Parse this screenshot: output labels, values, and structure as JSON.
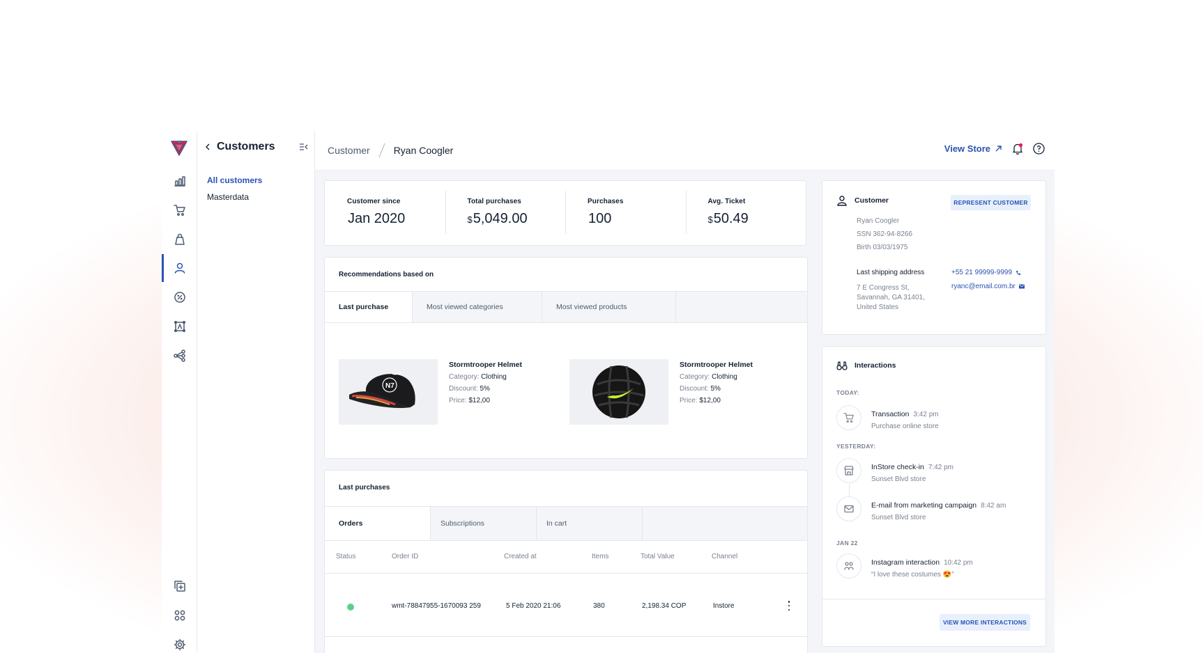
{
  "sidebar": {
    "icons": [
      "logo-icon",
      "dashboard-icon",
      "cart-icon",
      "bag-icon",
      "customer-icon",
      "promotion-icon",
      "catalog-icon",
      "connections-icon",
      "add-app-icon",
      "apps-icon",
      "settings-icon"
    ]
  },
  "subnav": {
    "title": "Customers",
    "links": [
      "All customers",
      "Masterdata"
    ]
  },
  "header": {
    "breadcrumb": [
      "Customer",
      "Ryan Coogler"
    ],
    "view_store": "View Store"
  },
  "stats": [
    {
      "label": "Customer since",
      "currency": "",
      "value": "Jan 2020"
    },
    {
      "label": "Total purchases",
      "currency": "$",
      "value": "5,049.00"
    },
    {
      "label": "Purchases",
      "currency": "",
      "value": "100"
    },
    {
      "label": "Avg. Ticket",
      "currency": "$",
      "value": "50.49"
    }
  ],
  "recommendations": {
    "title": "Recommendations based on",
    "tabs": [
      "Last purchase",
      "Most viewed categories",
      "Most viewed products"
    ],
    "products": [
      {
        "name": "Stormtrooper Helmet",
        "category_label": "Category:",
        "category": "Clothing",
        "discount_label": "Discount:",
        "discount": "5%",
        "price_label": "Price:",
        "price": "$12,00"
      },
      {
        "name": "Stormtrooper Helmet",
        "category_label": "Category:",
        "category": "Clothing",
        "discount_label": "Discount:",
        "discount": "5%",
        "price_label": "Price:",
        "price": "$12,00"
      }
    ]
  },
  "purchases": {
    "title": "Last purchases",
    "tabs": [
      "Orders",
      "Subscriptions",
      "In cart"
    ],
    "columns": [
      "Status",
      "Order ID",
      "Created at",
      "Items",
      "Total Value",
      "Channel"
    ],
    "rows": [
      {
        "status_color": "#5ecf89",
        "order_id": "wmt-78847955-1670093 259",
        "created_at": "5 Feb 2020  21:06",
        "items": "380",
        "total": "2,198.34 COP",
        "channel": "Instore"
      }
    ]
  },
  "customer": {
    "title": "Customer",
    "represent_button": "REPRESENT CUSTOMER",
    "name": "Ryan Coogler",
    "ssn": "SSN 362-94-8266",
    "birth": "Birth 03/03/1975",
    "shipping_label": "Last shipping address",
    "address": [
      "7 E Congress St,",
      "Savannah, GA 31401,",
      "United States"
    ],
    "phone": "+55 21 99999-9999",
    "email": "ryanc@email.com.br"
  },
  "interactions": {
    "title": "Interactions",
    "groups": [
      {
        "day": "TODAY:",
        "events": [
          {
            "icon": "cart-icon",
            "title": "Transaction",
            "time": "3:42 pm",
            "sub": "Purchase online store"
          }
        ]
      },
      {
        "day": "YESTERDAY:",
        "events": [
          {
            "icon": "store-icon",
            "title": "InStore check-in",
            "time": "7:42 pm",
            "sub": "Sunset Blvd store"
          },
          {
            "icon": "mail-icon",
            "title": "E-mail from marketing campaign",
            "time": "8:42 am",
            "sub": "Sunset Blvd store"
          }
        ]
      },
      {
        "day": "JAN 22",
        "events": [
          {
            "icon": "instagram-icon",
            "title": "Instagram interaction",
            "time": "10:42 pm",
            "sub": "“I love these costumes 😍”"
          }
        ]
      }
    ],
    "view_more": "VIEW MORE INTERACTIONS"
  }
}
